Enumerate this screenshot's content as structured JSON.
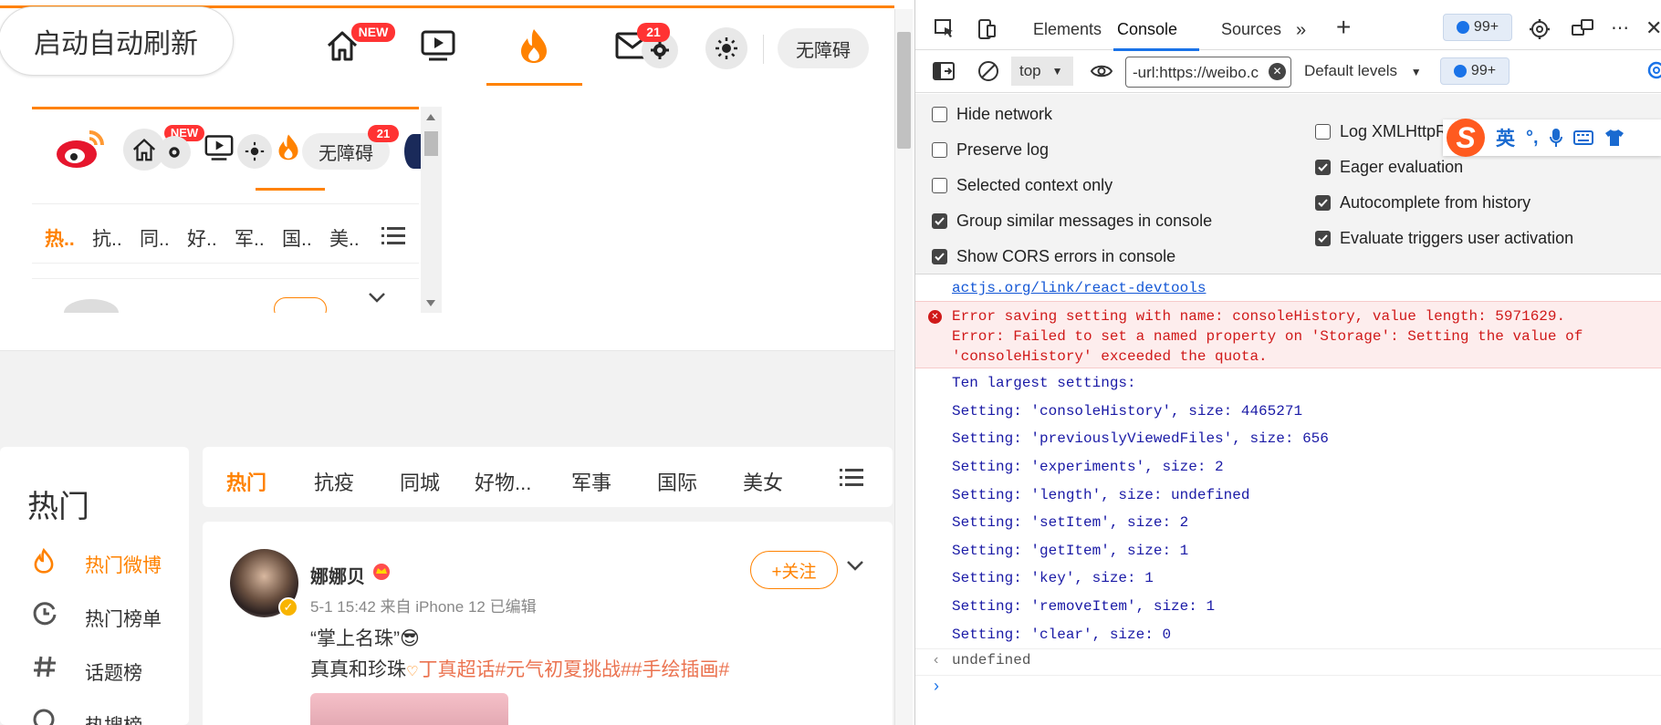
{
  "weibo": {
    "refresh_button": "启动自动刷新",
    "nav": {
      "home_badge": "NEW",
      "message_badge": "21",
      "accessibility": "无障碍"
    },
    "mini": {
      "home_badge": "NEW",
      "message_badge": "21",
      "accessibility": "无障碍",
      "tabs": [
        "热..",
        "抗..",
        "同..",
        "好..",
        "军..",
        "国..",
        "美.."
      ]
    },
    "sidebar": {
      "title": "热门",
      "items": [
        {
          "label": "热门微博",
          "icon": "flame-icon",
          "active": true
        },
        {
          "label": "热门榜单",
          "icon": "clock-icon",
          "active": false
        },
        {
          "label": "话题榜",
          "icon": "hash-icon",
          "active": false
        },
        {
          "label": "热搜榜",
          "icon": "search-icon",
          "active": false
        }
      ]
    },
    "tabs": [
      "热门",
      "抗疫",
      "同城",
      "好物...",
      "军事",
      "国际",
      "美女"
    ],
    "post": {
      "author": "娜娜贝",
      "meta": "5-1 15:42  来自 iPhone 12  已编辑",
      "follow": "+关注",
      "text1": "“掌上名珠”😎",
      "text2_plain": "真真和珍珠",
      "text2_link": "丁真超话#元气初夏挑战##手绘插画#"
    },
    "colors": {
      "accent": "#ff8200",
      "badge": "#ff3333"
    }
  },
  "devtools": {
    "tabs": [
      "Elements",
      "Console",
      "Sources"
    ],
    "active_tab": "Console",
    "issues_badge": "99+",
    "toolbar": {
      "context": "top",
      "filter": "-url:https://weibo.c",
      "levels": "Default levels",
      "issues": "99+"
    },
    "settings_left": [
      {
        "label": "Hide network",
        "checked": false
      },
      {
        "label": "Preserve log",
        "checked": false
      },
      {
        "label": "Selected context only",
        "checked": false
      },
      {
        "label": "Group similar messages in console",
        "checked": true
      },
      {
        "label": "Show CORS errors in console",
        "checked": true
      }
    ],
    "settings_right": [
      {
        "label": "Log XMLHttpRequests",
        "checked": false
      },
      {
        "label": "Eager evaluation",
        "checked": true
      },
      {
        "label": "Autocomplete from history",
        "checked": true
      },
      {
        "label": "Evaluate triggers user activation",
        "checked": true
      }
    ],
    "ime": {
      "mode": "英",
      "punct": "°,"
    },
    "console": {
      "link": "actjs.org/link/react-devtools",
      "error": [
        "Error saving setting with name: consoleHistory, value length: 5971629.",
        "Error: Failed to set a named property on 'Storage': Setting the value of",
        "'consoleHistory' exceeded the quota."
      ],
      "logs": [
        "Ten largest settings:",
        "Setting: 'consoleHistory', size: 4465271",
        "Setting: 'previouslyViewedFiles', size: 656",
        "Setting: 'experiments', size: 2",
        "Setting: 'length', size: undefined",
        "Setting: 'setItem', size: 2",
        "Setting: 'getItem', size: 1",
        "Setting: 'key', size: 1",
        "Setting: 'removeItem', size: 1",
        "Setting: 'clear', size: 0"
      ],
      "result": "undefined"
    },
    "colors": {
      "active_tab": "#1a73e8",
      "error_bg": "#fdeded",
      "error_text": "#d01a1a",
      "log_text": "#1a1aa6"
    }
  }
}
